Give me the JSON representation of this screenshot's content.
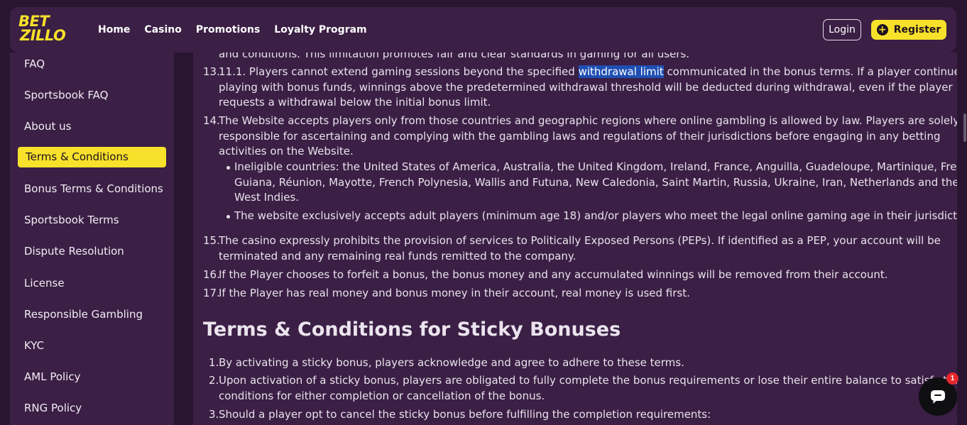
{
  "brand": {
    "line1": "BET",
    "line2": "ZILLO",
    "accent": "#f7e12a"
  },
  "nav": [
    "Home",
    "Casino",
    "Promotions",
    "Loyalty Program"
  ],
  "auth": {
    "login": "Login",
    "register": "Register"
  },
  "sidebar": {
    "items": [
      "FAQ",
      "Sportsbook FAQ",
      "About us",
      "Terms & Conditions",
      "Bonus Terms & Conditions",
      "Sportsbook Terms",
      "Dispute Resolution",
      "License",
      "Responsible Gambling",
      "KYC",
      "AML Policy",
      "RNG Policy"
    ],
    "active": "Terms & Conditions"
  },
  "content": {
    "cut_top": "and conditions. This limitation promotes fair and clear standards in gaming for all users.",
    "i13_num": "13.",
    "i13_a": "11.1. Players cannot extend gaming sessions beyond the specified ",
    "i13_hl": "withdrawal limit",
    "i13_b": " communicated in the bonus terms. If a player continues",
    "i13_l2": "playing with bonus funds, winnings above the predetermined withdrawal threshold will be deducted during withdrawal, even if the player",
    "i13_l3": "requests a withdrawal below the initial bonus limit.",
    "i14_num": "14.",
    "i14_l1": "The Website accepts players only from those countries and geographic regions where online gambling is allowed by law. Players are solely",
    "i14_l2": "responsible for ascertaining and complying with the gambling laws and regulations of their jurisdictions before engaging in any betting",
    "i14_l3": "activities on the Website.",
    "b1_l1": "Ineligible countries: the United States of America, Australia, the United Kingdom, Ireland, France, Anguilla, Guadeloupe, Martinique, French",
    "b1_l2": "Guiana, Réunion, Mayotte, French Polynesia, Wallis and Futuna, New Caledonia, Saint Martin, Russia, Ukraine, Iran, Netherlands and the Dutch",
    "b1_l3": "West Indies.",
    "b2_l1": "The website exclusively accepts adult players (minimum age 18) and/or players who meet the legal online gaming age in their jurisdiction.",
    "i15_num": "15.",
    "i15_l1": "The casino expressly prohibits the provision of services to Politically Exposed Persons (PEPs). If identified as a PEP, your account will be",
    "i15_l2": "terminated and any remaining real funds remitted to the company.",
    "i16_num": "16.",
    "i16_l1": "If the Player chooses to forfeit a bonus, the bonus money and any accumulated winnings will be removed from their account.",
    "i17_num": "17.",
    "i17_l1": "If the Player has real money and bonus money in their account, real money is used first.",
    "heading": "Terms & Conditions for Sticky Bonuses",
    "s1_num": "1.",
    "s1_l1": "By activating a sticky bonus, players acknowledge and agree to adhere to these terms.",
    "s2_num": "2.",
    "s2_l1": "Upon activation of a sticky bonus, players are obligated to fully complete the bonus requirements or lose their entire balance to satisfy the",
    "s2_l2": "conditions for either completion or cancellation of the bonus.",
    "s3_num": "3.",
    "s3_l1": "Should a player opt to cancel the sticky bonus before fulfilling the completion requirements:"
  },
  "chat": {
    "badge": "1"
  }
}
